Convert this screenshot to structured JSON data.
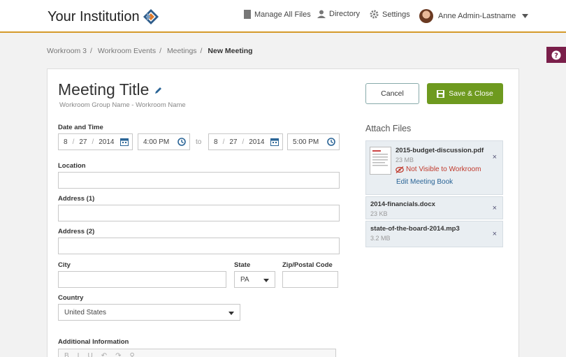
{
  "header": {
    "brand": "Your Institution",
    "nav": {
      "manage_files": "Manage All Files",
      "directory": "Directory",
      "settings": "Settings",
      "user_name": "Anne Admin-Lastname"
    }
  },
  "breadcrumb": [
    "Workroom 3",
    "Workroom Events",
    "Meetings",
    "New Meeting"
  ],
  "form": {
    "title": "Meeting Title",
    "subtitle": "Workroom Group Name - Workroom Name",
    "date_time_label": "Date and Time",
    "start_date": {
      "month": "8",
      "day": "27",
      "year": "2014"
    },
    "start_time": "4:00 PM",
    "to_label": "to",
    "end_date": {
      "month": "8",
      "day": "27",
      "year": "2014"
    },
    "end_time": "5:00 PM",
    "location_label": "Location",
    "location_value": "",
    "address1_label": "Address (1)",
    "address1_value": "",
    "address2_label": "Address (2)",
    "address2_value": "",
    "city_label": "City",
    "city_value": "",
    "state_label": "State",
    "state_value": "PA",
    "zip_label": "Zip/Postal Code",
    "zip_value": "",
    "country_label": "Country",
    "country_value": "United States",
    "additional_label": "Additional Information",
    "editor_toolbar": [
      "B",
      "I",
      "U",
      "↶",
      "↷",
      "⚲"
    ]
  },
  "actions": {
    "cancel": "Cancel",
    "save_close": "Save & Close"
  },
  "attachments": {
    "title": "Attach Files",
    "files": [
      {
        "name": "2015-budget-discussion.pdf",
        "size": "23 MB",
        "warning": "Not Visible to Workroom",
        "link": "Edit Meeting Book"
      },
      {
        "name": "2014-financials.docx",
        "size": "23 KB"
      },
      {
        "name": "state-of-the-board-2014.mp3",
        "size": "3.2 MB"
      }
    ],
    "remove_symbol": "×"
  },
  "colors": {
    "accent": "#d49a2a",
    "save_green": "#6e9a1f",
    "help_purple": "#7a1f4a",
    "warning_red": "#c0392b"
  }
}
